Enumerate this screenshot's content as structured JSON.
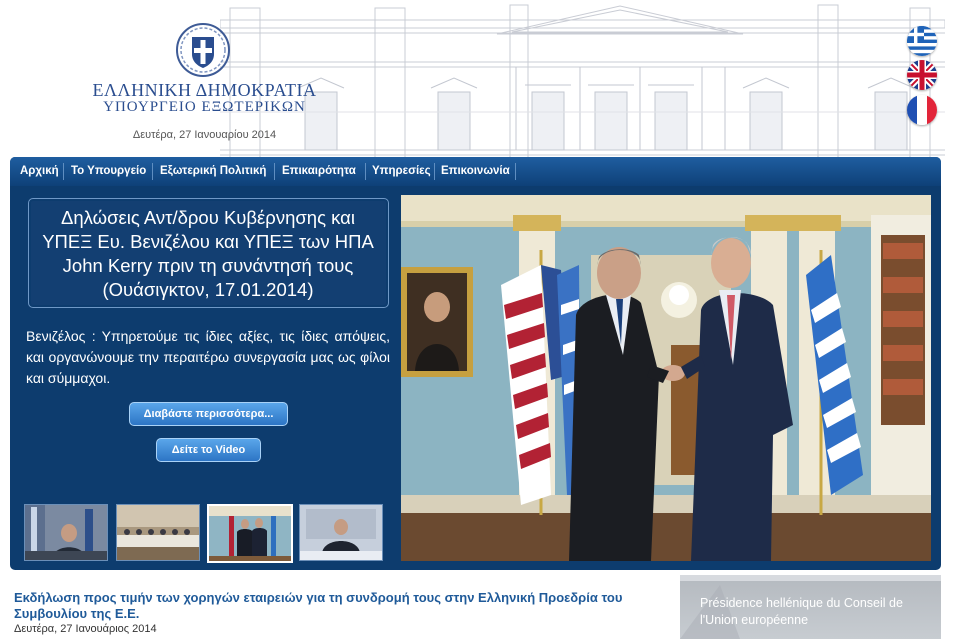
{
  "header": {
    "brand_line1": "ΕΛΛΗΝΙΚΗ ΔΗΜΟΚΡΑΤΙΑ",
    "brand_line2": "ΥΠΟΥΡΓΕΙΟ ΕΞΩΤΕΡΙΚΩΝ",
    "date": "Δευτέρα, 27 Ιανουαρίου 2014"
  },
  "languages": [
    {
      "icon": "greek-flag-icon"
    },
    {
      "icon": "uk-flag-icon"
    },
    {
      "icon": "french-flag-icon"
    }
  ],
  "nav": {
    "items": [
      {
        "label": "Αρχική"
      },
      {
        "label": "Το Υπουργείο"
      },
      {
        "label": "Εξωτερική Πολιτική"
      },
      {
        "label": "Επικαιρότητα"
      },
      {
        "label": "Υπηρεσίες"
      },
      {
        "label": "Επικοινωνία"
      }
    ]
  },
  "feature": {
    "headline": "Δηλώσεις Αντ/δρου Κυβέρνησης και ΥΠΕΞ Ευ. Βενιζέλου και ΥΠΕΞ των ΗΠΑ John Kerry πριν τη συνάντησή τους (Ουάσιγκτον, 17.01.2014)",
    "summary": "Βενιζέλος : Υπηρετούμε τις ίδιες αξίες, τις ίδιες απόψεις, και οργανώνουμε την περαιτέρω συνεργασία μας ως φίλοι και σύμμαχοι.",
    "read_more_label": "Διαβάστε περισσότερα...",
    "video_label": "Δείτε το Video"
  },
  "news": {
    "title": "Εκδήλωση προς τιμήν των χορηγών εταιρειών για τη συνδρομή τους στην Ελληνική Προεδρία του Συμβουλίου της Ε.Ε.",
    "date": "Δευτέρα, 27 Ιανουάριος 2014"
  },
  "banner": {
    "text": "Présidence hellénique du Conseil de l'Union européenne"
  },
  "colors": {
    "panel": "#0d3c6e",
    "nav": "#1f5ea0",
    "brand": "#2a4d8f",
    "news_title": "#1f5a99"
  }
}
